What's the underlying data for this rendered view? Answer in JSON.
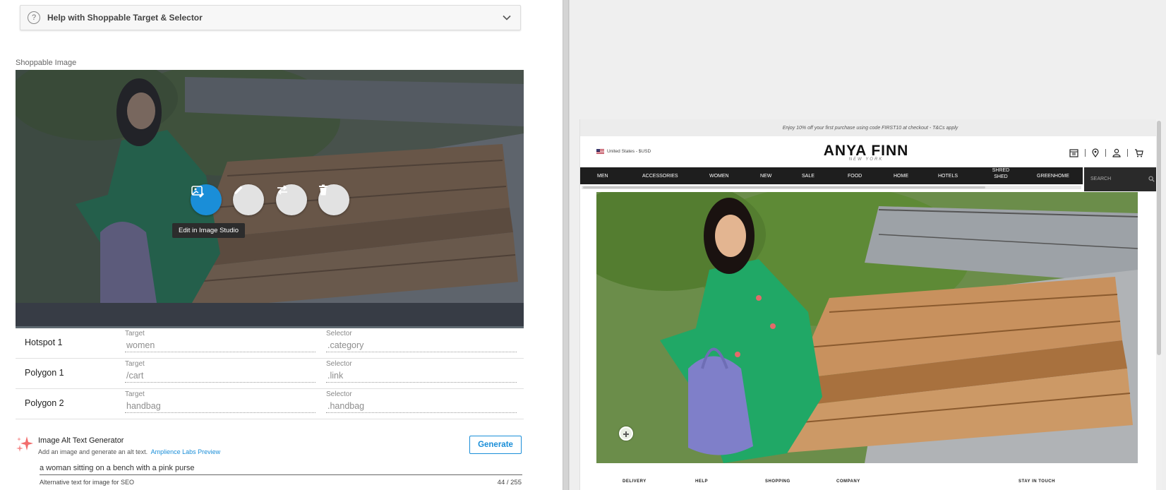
{
  "help": {
    "title": "Help with Shoppable Target & Selector",
    "icon": "question-icon"
  },
  "shoppable": {
    "label": "Shoppable Image",
    "actions": [
      {
        "name": "edit-in-image-studio-button",
        "icon": "image-edit-icon",
        "tooltip": "Edit in Image Studio"
      },
      {
        "name": "edit-button",
        "icon": "pencil-icon"
      },
      {
        "name": "swap-button",
        "icon": "swap-icon"
      },
      {
        "name": "delete-button",
        "icon": "trash-icon"
      }
    ],
    "tooltip": "Edit in Image Studio"
  },
  "hotspots": [
    {
      "name": "Hotspot 1",
      "target_label": "Target",
      "target": "women",
      "selector_label": "Selector",
      "selector": ".category"
    },
    {
      "name": "Polygon 1",
      "target_label": "Target",
      "target": "/cart",
      "selector_label": "Selector",
      "selector": ".link"
    },
    {
      "name": "Polygon 2",
      "target_label": "Target",
      "target": "handbag",
      "selector_label": "Selector",
      "selector": ".handbag"
    }
  ],
  "alt_text": {
    "title": "Image Alt Text Generator",
    "subtitle": "Add an image and generate an alt text.",
    "link": "Amplience Labs Preview",
    "button": "Generate",
    "value": "a woman sitting on a bench with a pink purse",
    "helper": "Alternative text for image for SEO",
    "count": "44 / 255"
  },
  "preview": {
    "promo": "Enjoy 10% off your first purchase using code FIRST10 at checkout - T&Cs apply",
    "locale": "United States - $USD",
    "brand": "ANYA FINN",
    "brand_sub": "NEW YORK",
    "nav": [
      "MEN",
      "ACCESSORIES",
      "WOMEN",
      "NEW",
      "SALE",
      "FOOD",
      "HOME",
      "HOTELS",
      "SHRED SHED",
      "GREENHOME"
    ],
    "search_placeholder": "SEARCH",
    "footer": [
      "DELIVERY",
      "HELP",
      "SHOPPING",
      "COMPANY",
      "STAY IN TOUCH"
    ]
  },
  "colors": {
    "accent": "#1a8ed8",
    "nav_bg": "#1e1e1e"
  }
}
